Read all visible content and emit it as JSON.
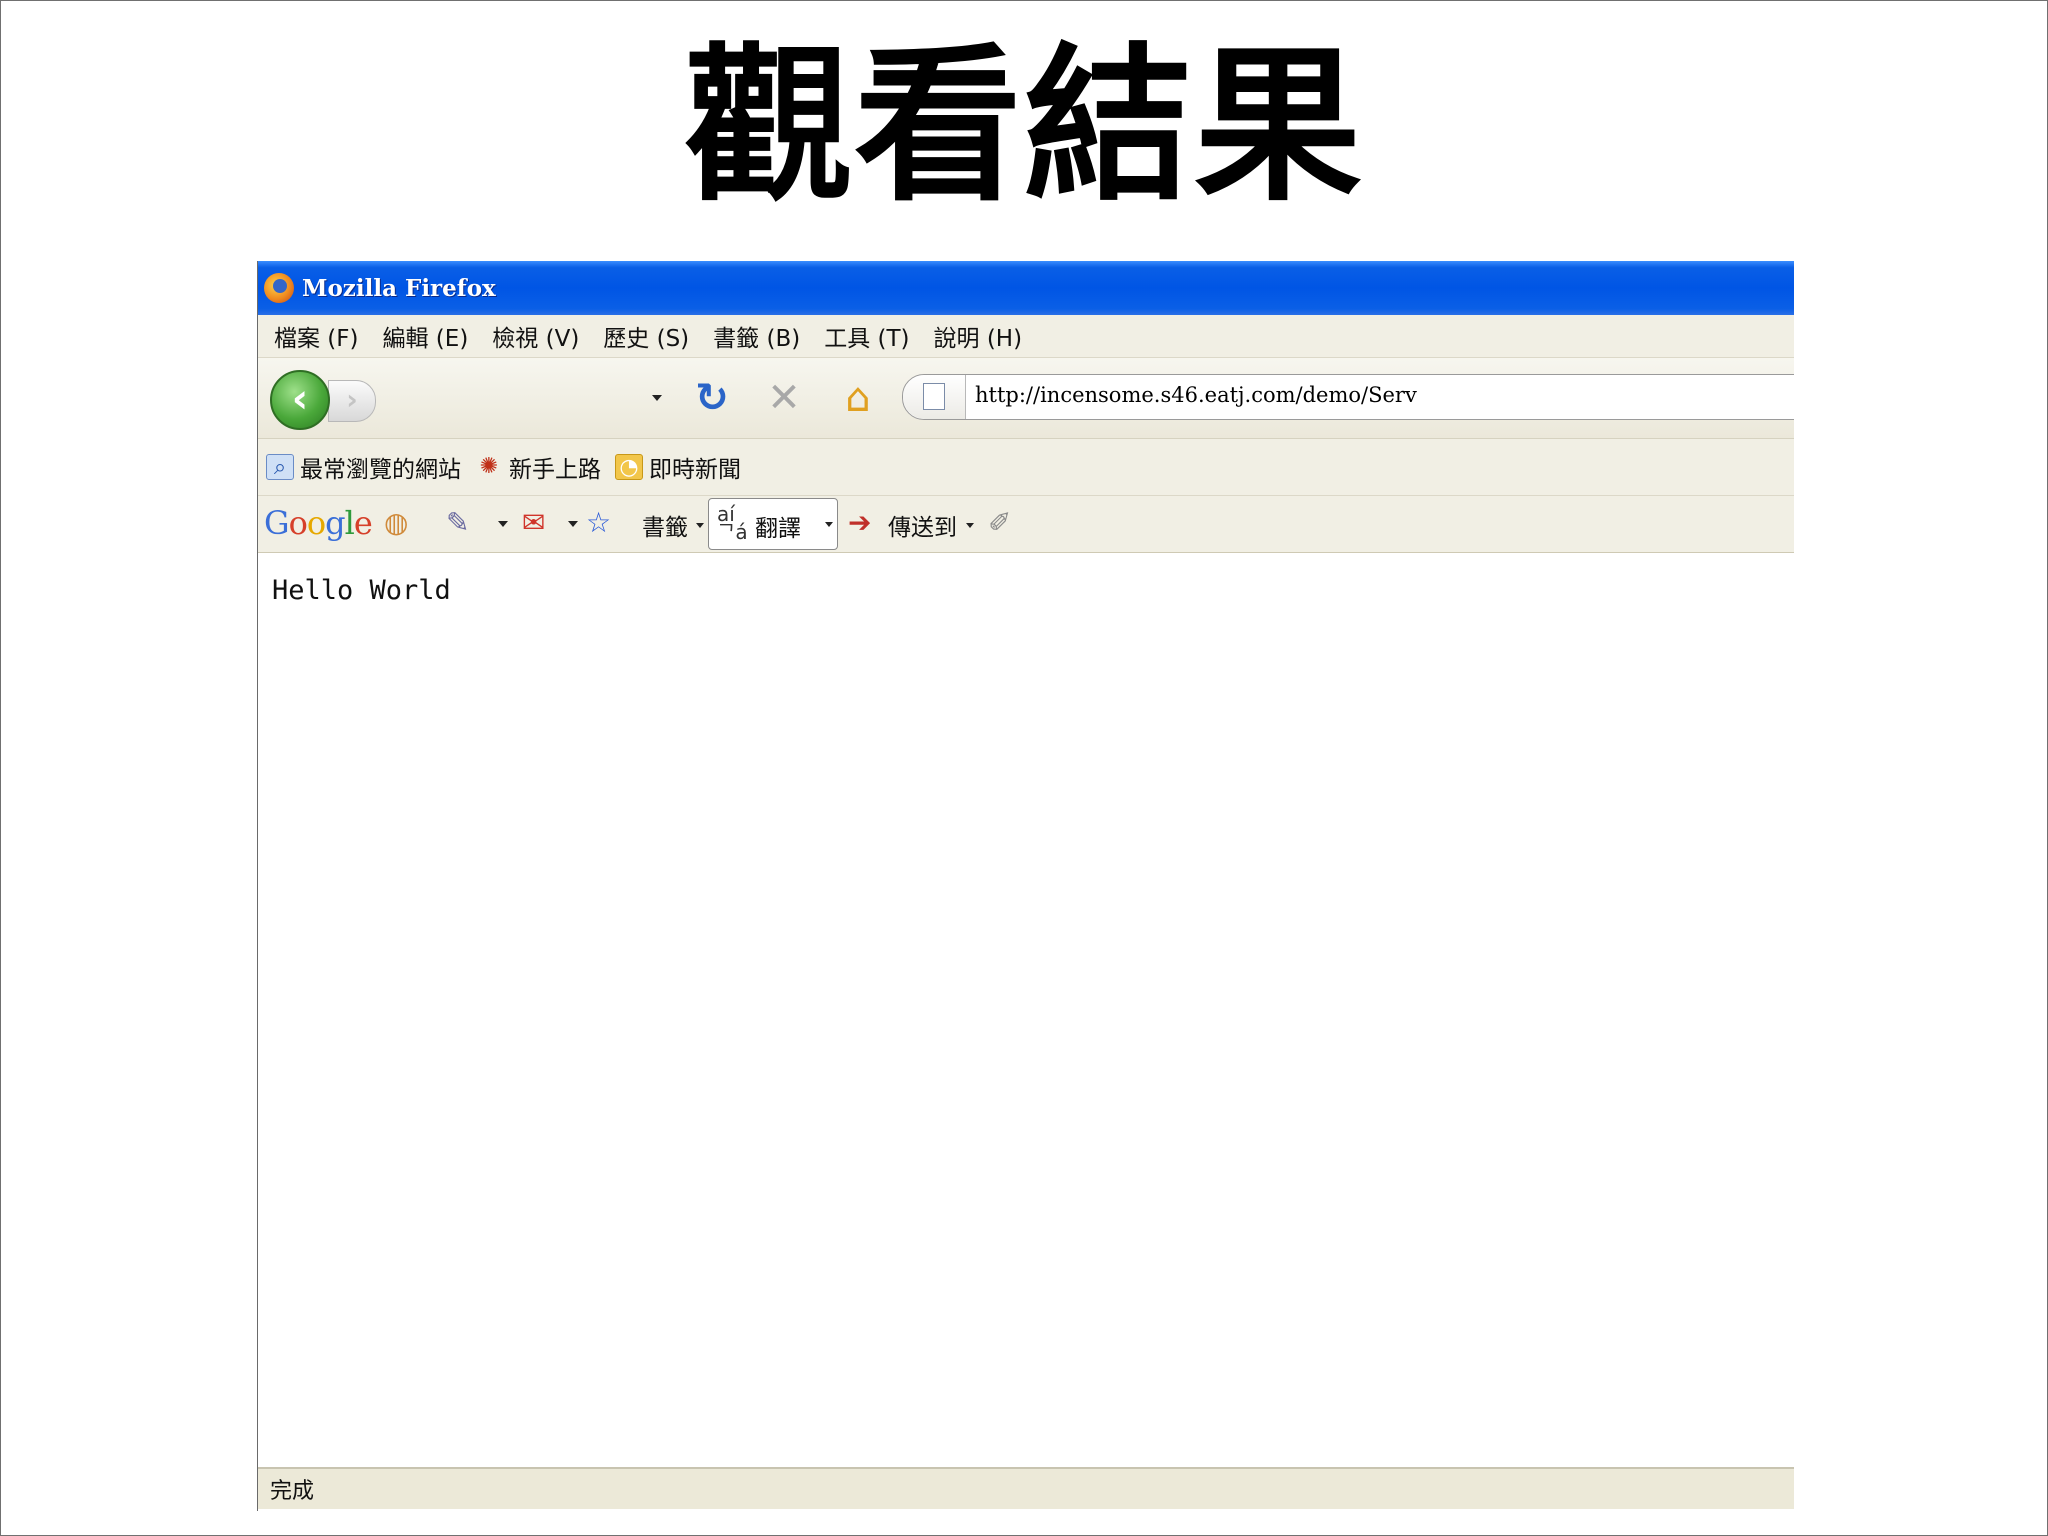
{
  "slide": {
    "title": "觀看結果"
  },
  "window": {
    "title": "Mozilla Firefox"
  },
  "menu": {
    "items": [
      "檔案 (F)",
      "編輯 (E)",
      "檢視 (V)",
      "歷史 (S)",
      "書籤 (B)",
      "工具 (T)",
      "說明 (H)"
    ]
  },
  "navigation": {
    "url": "http://incensome.s46.eatj.com/demo/Serv"
  },
  "bookmarks": {
    "items": [
      "最常瀏覽的網站",
      "新手上路",
      "即時新聞"
    ]
  },
  "google_toolbar": {
    "logo": "Google",
    "bookmarks_label": "書籤",
    "translate_label": "翻譯",
    "send_to_label": "傳送到"
  },
  "page": {
    "body_text": "Hello World"
  },
  "status": {
    "text": "完成"
  }
}
